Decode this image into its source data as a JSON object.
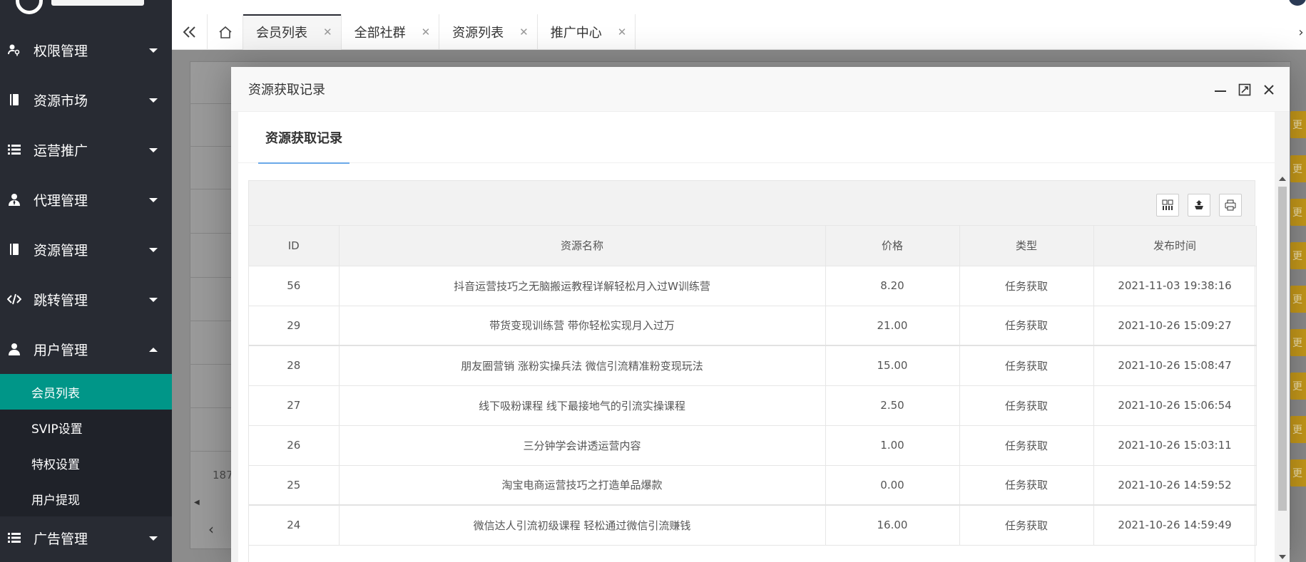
{
  "sidebar": {
    "menu": [
      {
        "label": "权限管理",
        "icon": "key-user-icon"
      },
      {
        "label": "资源市场",
        "icon": "book-icon"
      },
      {
        "label": "运营推广",
        "icon": "list-icon"
      },
      {
        "label": "代理管理",
        "icon": "agent-icon"
      },
      {
        "label": "资源管理",
        "icon": "book-icon"
      },
      {
        "label": "跳转管理",
        "icon": "code-icon"
      },
      {
        "label": "用户管理",
        "icon": "user-icon"
      }
    ],
    "submenu": [
      {
        "label": "会员列表",
        "active": true
      },
      {
        "label": "SVIP设置"
      },
      {
        "label": "特权设置"
      },
      {
        "label": "用户提现"
      }
    ],
    "ad_menu": {
      "label": "广告管理",
      "icon": "list-icon"
    }
  },
  "tabs": [
    {
      "label": "会员列表",
      "active": true
    },
    {
      "label": "全部社群"
    },
    {
      "label": "资源列表"
    },
    {
      "label": "推广中心"
    }
  ],
  "background": {
    "count_text": "187",
    "orange_tag_text": "更"
  },
  "modal": {
    "title": "资源获取记录",
    "card_tab": "资源获取记录",
    "columns": [
      "ID",
      "资源名称",
      "价格",
      "类型",
      "发布时间"
    ],
    "rows": [
      {
        "id": "56",
        "name": "抖音运营技巧之无脑搬运教程详解轻松月入过W训练营",
        "price": "8.20",
        "type": "任务获取",
        "time": "2021-11-03 19:38:16"
      },
      {
        "id": "29",
        "name": "带货变现训练营 带你轻松实现月入过万",
        "price": "21.00",
        "type": "任务获取",
        "time": "2021-10-26 15:09:27"
      },
      {
        "id": "28",
        "name": "朋友圈营销 涨粉实操兵法 微信引流精准粉变现玩法",
        "price": "15.00",
        "type": "任务获取",
        "time": "2021-10-26 15:08:47"
      },
      {
        "id": "27",
        "name": "线下吸粉课程 线下最接地气的引流实操课程",
        "price": "2.50",
        "type": "任务获取",
        "time": "2021-10-26 15:06:54"
      },
      {
        "id": "26",
        "name": "三分钟学会讲透运营内容",
        "price": "1.00",
        "type": "任务获取",
        "time": "2021-10-26 15:03:11"
      },
      {
        "id": "25",
        "name": "淘宝电商运营技巧之打造单品爆款",
        "price": "0.00",
        "type": "任务获取",
        "time": "2021-10-26 14:59:52"
      },
      {
        "id": "24",
        "name": "微信达人引流初级课程 轻松通过微信引流赚钱",
        "price": "16.00",
        "type": "任务获取",
        "time": "2021-10-26 14:59:49"
      }
    ]
  },
  "colors": {
    "sidebar_bg": "#282b33",
    "active_green": "#009688",
    "tab_underline": "#6aa8e8",
    "orange_tag": "#c79a1a"
  }
}
